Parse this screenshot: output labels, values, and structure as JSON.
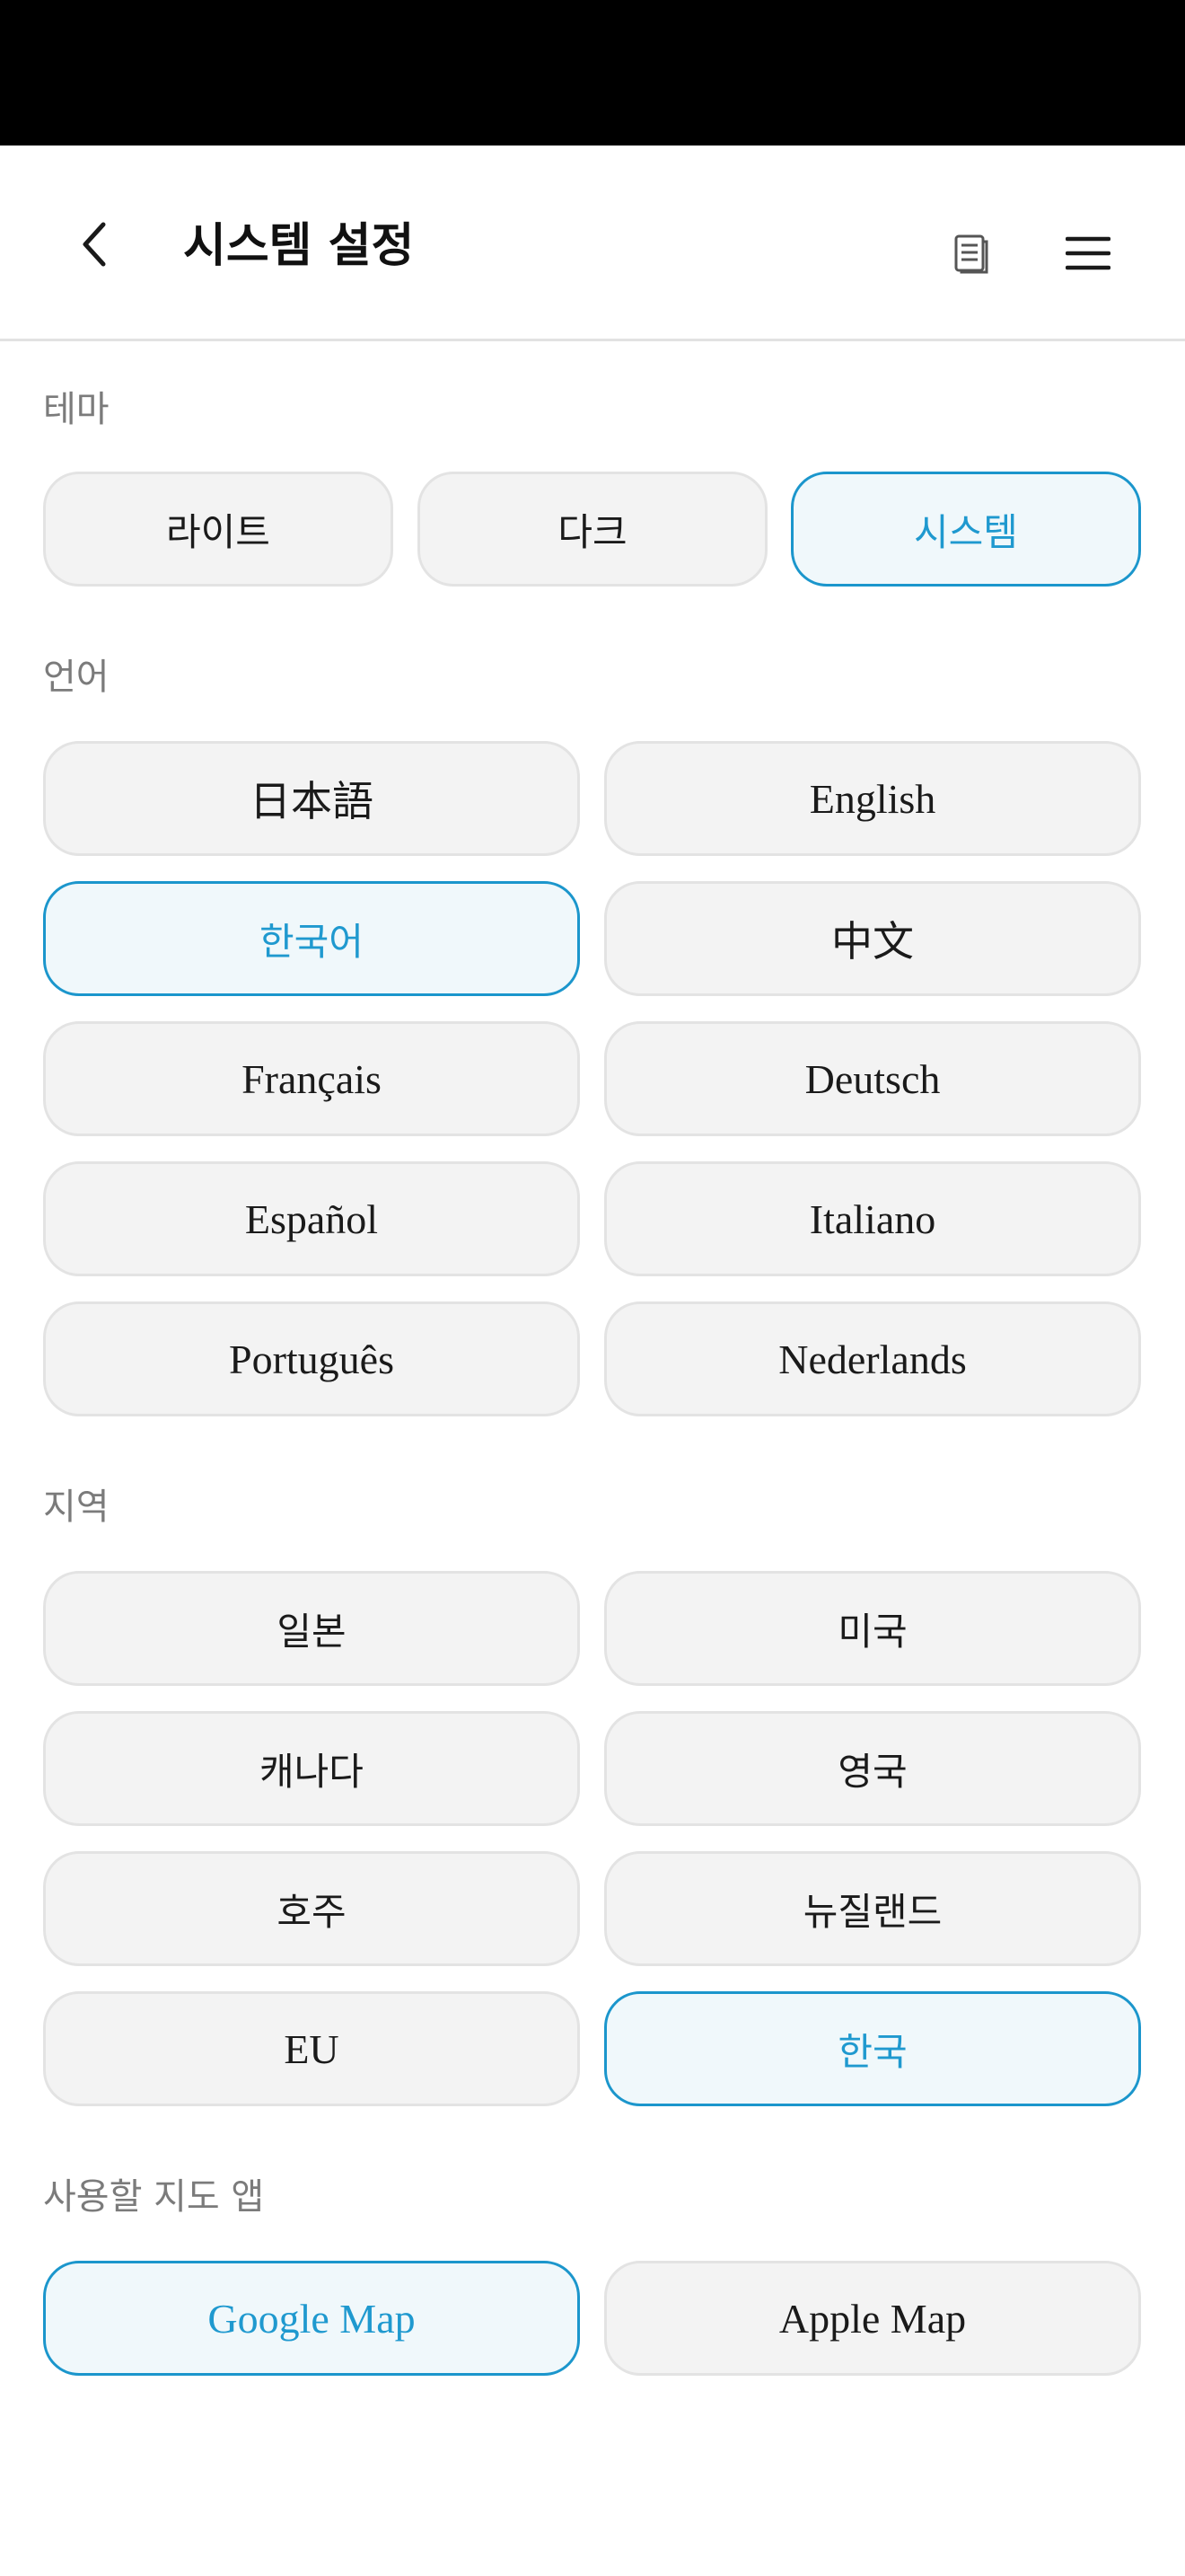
{
  "header": {
    "title": "시스템 설정",
    "back_icon": "chevron-left-icon",
    "doc_icon": "document-icon",
    "menu_icon": "hamburger-menu-icon"
  },
  "colors": {
    "accent": "#1b96cc",
    "selected_bg": "#f0f8fb",
    "option_bg": "#f3f3f3",
    "label_gray": "#7b7b7b"
  },
  "theme": {
    "label": "테마",
    "options": [
      "라이트",
      "다크",
      "시스템"
    ],
    "selected": "시스템"
  },
  "language": {
    "label": "언어",
    "options": [
      "日本語",
      "English",
      "한국어",
      "中文",
      "Français",
      "Deutsch",
      "Español",
      "Italiano",
      "Português",
      "Nederlands"
    ],
    "selected": "한국어"
  },
  "region": {
    "label": "지역",
    "options": [
      "일본",
      "미국",
      "캐나다",
      "영국",
      "호주",
      "뉴질랜드",
      "EU",
      "한국"
    ],
    "selected": "한국"
  },
  "map_app": {
    "label": "사용할 지도 앱",
    "options": [
      "Google Map",
      "Apple Map"
    ],
    "selected": "Google Map"
  }
}
